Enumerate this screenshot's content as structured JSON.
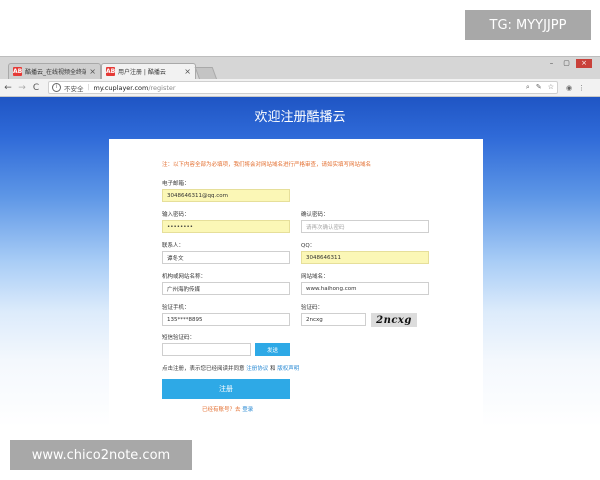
{
  "watermarks": {
    "top_right": "TG: MYYJJPP",
    "bottom_left": "www.chico2note.com"
  },
  "browser": {
    "tabs": [
      {
        "favicon": "AB",
        "title": "酷播云_在线视频全终端",
        "close": "×"
      },
      {
        "favicon": "AB",
        "title": "用户注册 | 酷播云",
        "close": "×"
      }
    ],
    "window_controls": [
      "–",
      "▢",
      "×"
    ],
    "nav": {
      "back": "←",
      "forward": "→",
      "reload": "C"
    },
    "address": {
      "security_label": "不安全",
      "host": "my.cuplayer.com",
      "path": "/register"
    },
    "toolbar_icons": [
      "search-icon",
      "pin-icon",
      "star-icon",
      "extension-icon",
      "menu-icon"
    ]
  },
  "page": {
    "title": "欢迎注册酷播云",
    "notice": "注：以下内容全部为必填项，我们将会对网站域名进行严格审查，请如实填写网站域名",
    "form": {
      "email": {
        "label": "电子邮箱：",
        "value": "3048646311@qq.com"
      },
      "password": {
        "label": "输入密码：",
        "value": "••••••••"
      },
      "confirm_password": {
        "label": "确认密码：",
        "placeholder": "请再次确认密码"
      },
      "contact": {
        "label": "联系人：",
        "value": "谭冬文"
      },
      "qq": {
        "label": "QQ：",
        "value": "3048646311"
      },
      "org_name": {
        "label": "机构或网站名称：",
        "value": "广州海豹传媒"
      },
      "domain": {
        "label": "网站域名：",
        "value": "www.haihong.com"
      },
      "phone": {
        "label": "验证手机：",
        "value": "135****8895"
      },
      "captcha": {
        "label": "验证码：",
        "value": "2ncxg",
        "image_text": "2ncxg"
      },
      "sms_code": {
        "label": "短信验证码：",
        "value": "",
        "send_button": "发送"
      }
    },
    "agreement": {
      "prefix": "点击注册，表示您已经阅读并同意 ",
      "link1": "注册协议",
      "and": " 和 ",
      "link2": "版权声明"
    },
    "submit_label": "注册",
    "login_prompt": {
      "text": "已经有账号？去 ",
      "link": "登录"
    }
  }
}
